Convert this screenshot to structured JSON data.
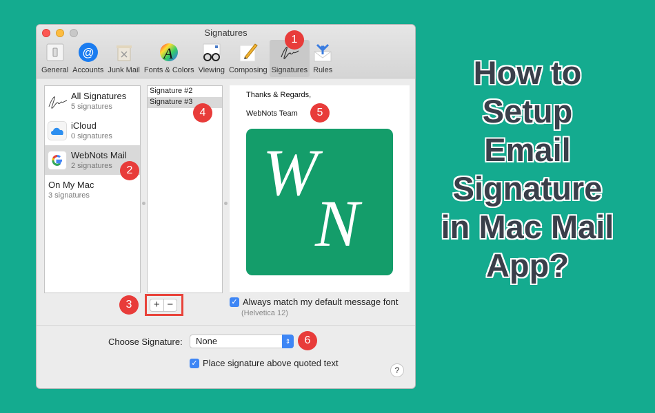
{
  "window": {
    "title": "Signatures",
    "toolbar": [
      {
        "label": "General",
        "icon": "general-switch-icon"
      },
      {
        "label": "Accounts",
        "icon": "at-sign-icon"
      },
      {
        "label": "Junk Mail",
        "icon": "trash-bin-icon"
      },
      {
        "label": "Fonts & Colors",
        "icon": "color-wheel-icon"
      },
      {
        "label": "Viewing",
        "icon": "glasses-icon"
      },
      {
        "label": "Composing",
        "icon": "pencil-paper-icon"
      },
      {
        "label": "Signatures",
        "icon": "signature-icon",
        "active": true
      },
      {
        "label": "Rules",
        "icon": "rules-envelope-icon"
      }
    ]
  },
  "accounts": [
    {
      "name": "All Signatures",
      "count": "5 signatures",
      "icon": "signature-icon"
    },
    {
      "name": "iCloud",
      "count": "0 signatures",
      "icon": "icloud-icon"
    },
    {
      "name": "WebNots Mail",
      "count": "2 signatures",
      "icon": "google-icon",
      "selected": true
    },
    {
      "name": "On My Mac",
      "count": "3 signatures",
      "icon": null
    }
  ],
  "signatures": [
    {
      "name": "Signature #2"
    },
    {
      "name": "Signature #3",
      "selected": true
    }
  ],
  "preview": {
    "line1": "Thanks & Regards,",
    "line2": "WebNots Team",
    "logo_letter1": "W",
    "logo_letter2": "N",
    "logo_color": "#149d6a"
  },
  "controls": {
    "add_label": "+",
    "remove_label": "−",
    "match_font_label": "Always match my default message font",
    "match_font_checked": true,
    "font_hint": "(Helvetica 12)",
    "choose_label": "Choose Signature:",
    "choose_value": "None",
    "place_above_label": "Place signature above quoted text",
    "place_above_checked": true,
    "help_label": "?"
  },
  "badges": [
    "1",
    "2",
    "3",
    "4",
    "5",
    "6"
  ],
  "headline": [
    "How to",
    "Setup",
    "Email",
    "Signature",
    "in Mac Mail",
    "App?"
  ],
  "colors": {
    "background": "#14ab8f",
    "badge": "#e83c3a",
    "accent": "#3e86f5"
  }
}
